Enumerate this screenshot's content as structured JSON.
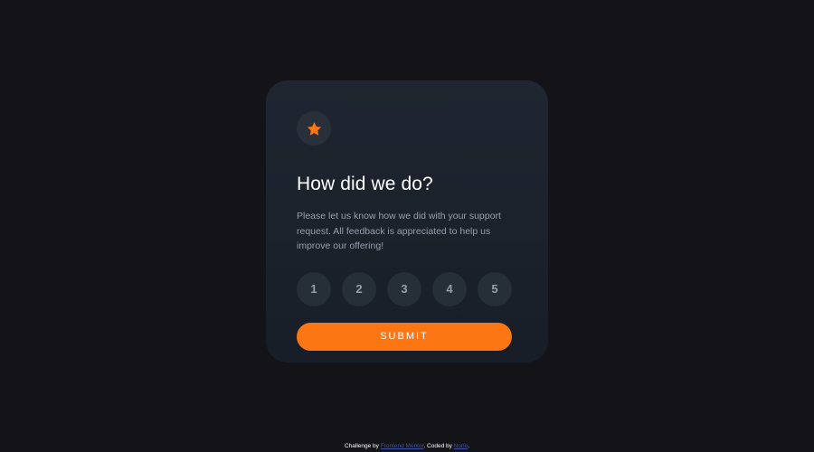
{
  "card": {
    "icon": "star-icon",
    "title": "How did we do?",
    "description": "Please let us know how we did with your support request. All feedback is appreciated to help us improve our offering!",
    "ratings": [
      "1",
      "2",
      "3",
      "4",
      "5"
    ],
    "submit_label": "SUBMIT"
  },
  "footer": {
    "prefix": "Challenge by ",
    "challenge_link": "Frontend Mentor",
    "middle": ". Coded by ",
    "author_link": "Nono",
    "suffix": "."
  },
  "colors": {
    "background": "#131318",
    "card": "#1f2631",
    "accent": "#fc7614",
    "rating_bg": "#262e38",
    "muted_text": "#969fad",
    "link": "#3e52a3"
  }
}
